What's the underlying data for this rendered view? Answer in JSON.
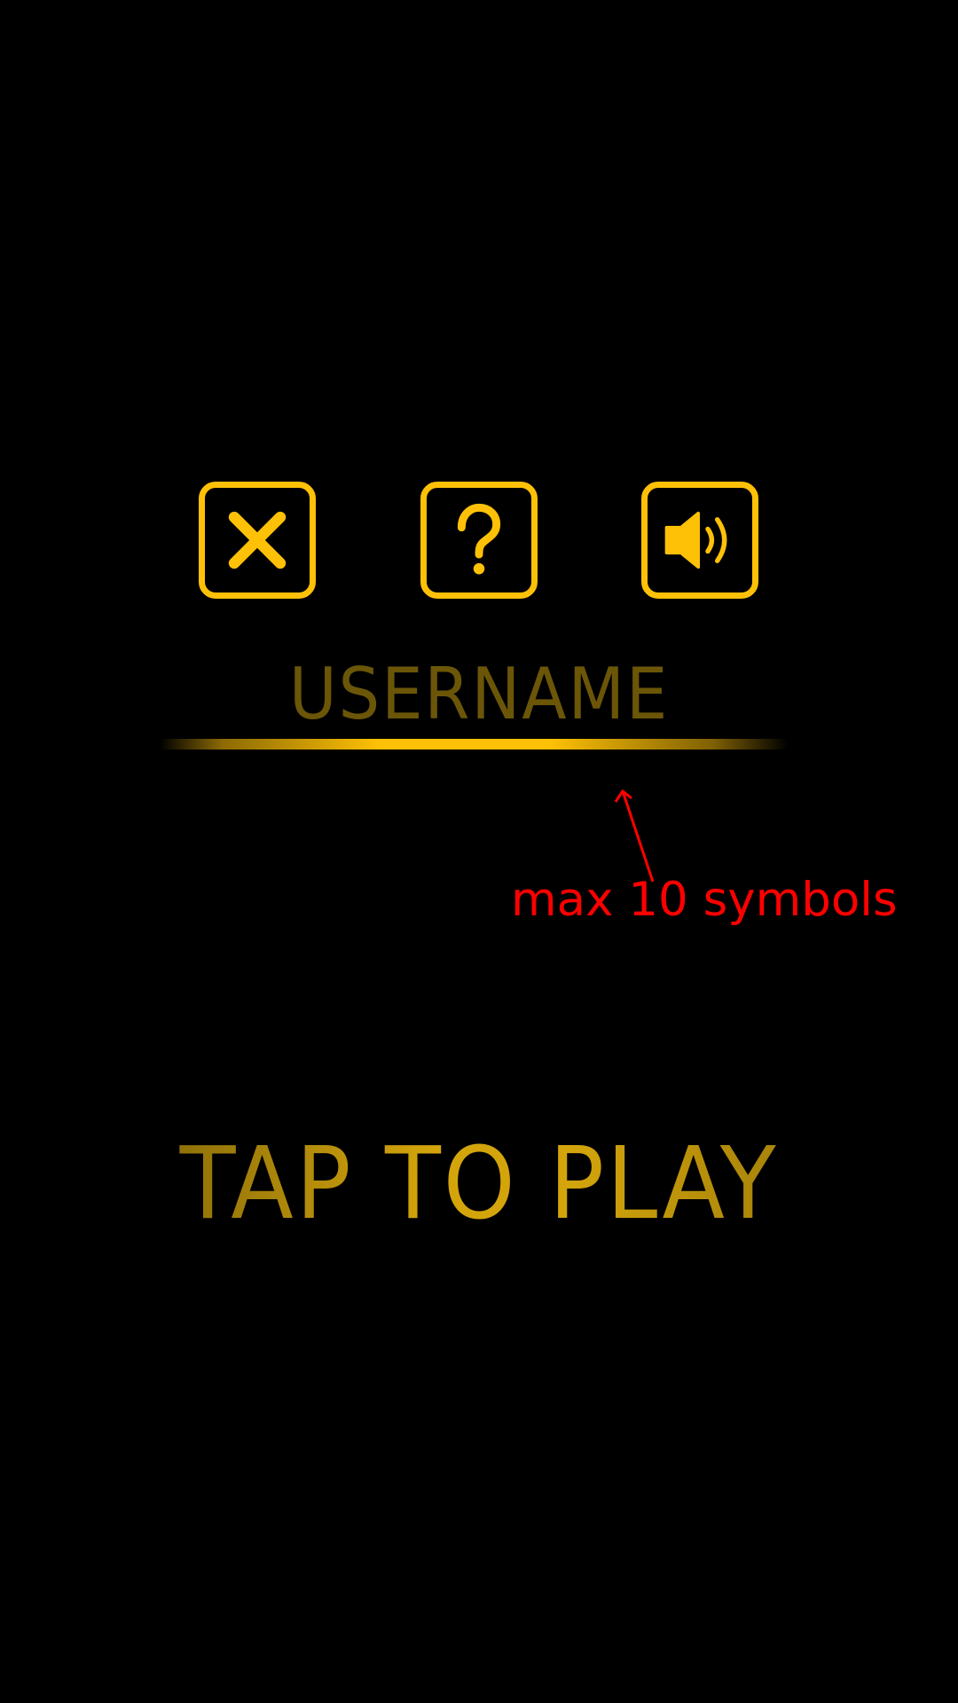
{
  "toolbar": {
    "close_icon": "close-icon",
    "help_icon": "question-icon",
    "sound_icon": "speaker-icon"
  },
  "username_field": {
    "label": "USERNAME"
  },
  "annotation": {
    "text": "max 10 symbols"
  },
  "play": {
    "label": "TAP TO PLAY"
  },
  "colors": {
    "accent": "#FFC107",
    "muted_text": "#6B5608",
    "annotation": "#FF0000",
    "background": "#000000"
  }
}
